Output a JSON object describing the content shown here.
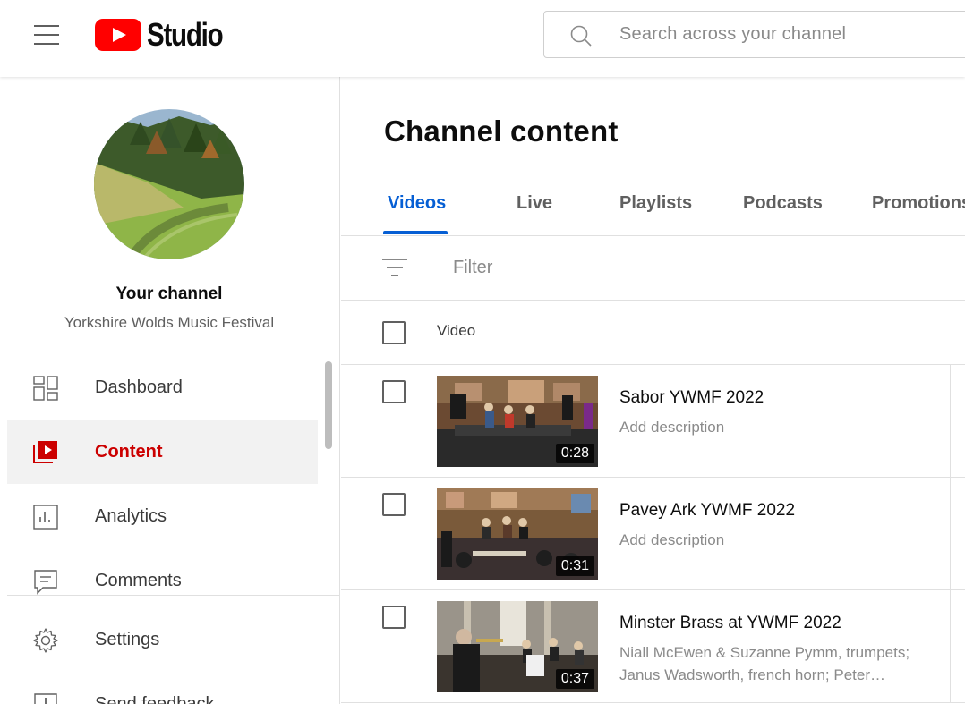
{
  "header": {
    "logo_text": "Studio",
    "search_placeholder": "Search across your channel"
  },
  "sidebar": {
    "channel_label": "Your channel",
    "channel_name": "Yorkshire Wolds Music Festival",
    "items": [
      {
        "label": "Dashboard",
        "icon": "dashboard-icon",
        "active": false
      },
      {
        "label": "Content",
        "icon": "content-icon",
        "active": true
      },
      {
        "label": "Analytics",
        "icon": "analytics-icon",
        "active": false
      },
      {
        "label": "Comments",
        "icon": "comments-icon",
        "active": false
      },
      {
        "label": "Settings",
        "icon": "settings-icon",
        "active": false
      },
      {
        "label": "Send feedback",
        "icon": "feedback-icon",
        "active": false
      }
    ]
  },
  "main": {
    "title": "Channel content",
    "tabs": [
      {
        "label": "Videos",
        "active": true
      },
      {
        "label": "Live",
        "active": false
      },
      {
        "label": "Playlists",
        "active": false
      },
      {
        "label": "Podcasts",
        "active": false
      },
      {
        "label": "Promotions",
        "active": false
      }
    ],
    "filter_placeholder": "Filter",
    "column_header": "Video",
    "videos": [
      {
        "title": "Sabor YWMF 2022",
        "description": "Add description",
        "duration": "0:28"
      },
      {
        "title": "Pavey Ark YWMF 2022",
        "description": "Add description",
        "duration": "0:31"
      },
      {
        "title": "Minster Brass at YWMF 2022",
        "description": "Niall McEwen & Suzanne Pymm, trumpets; Janus Wadsworth, french horn; Peter…",
        "duration": "0:37"
      }
    ]
  },
  "colors": {
    "accent_blue": "#065fd4",
    "active_red": "#cc0000",
    "brand_red": "#ff0000"
  }
}
